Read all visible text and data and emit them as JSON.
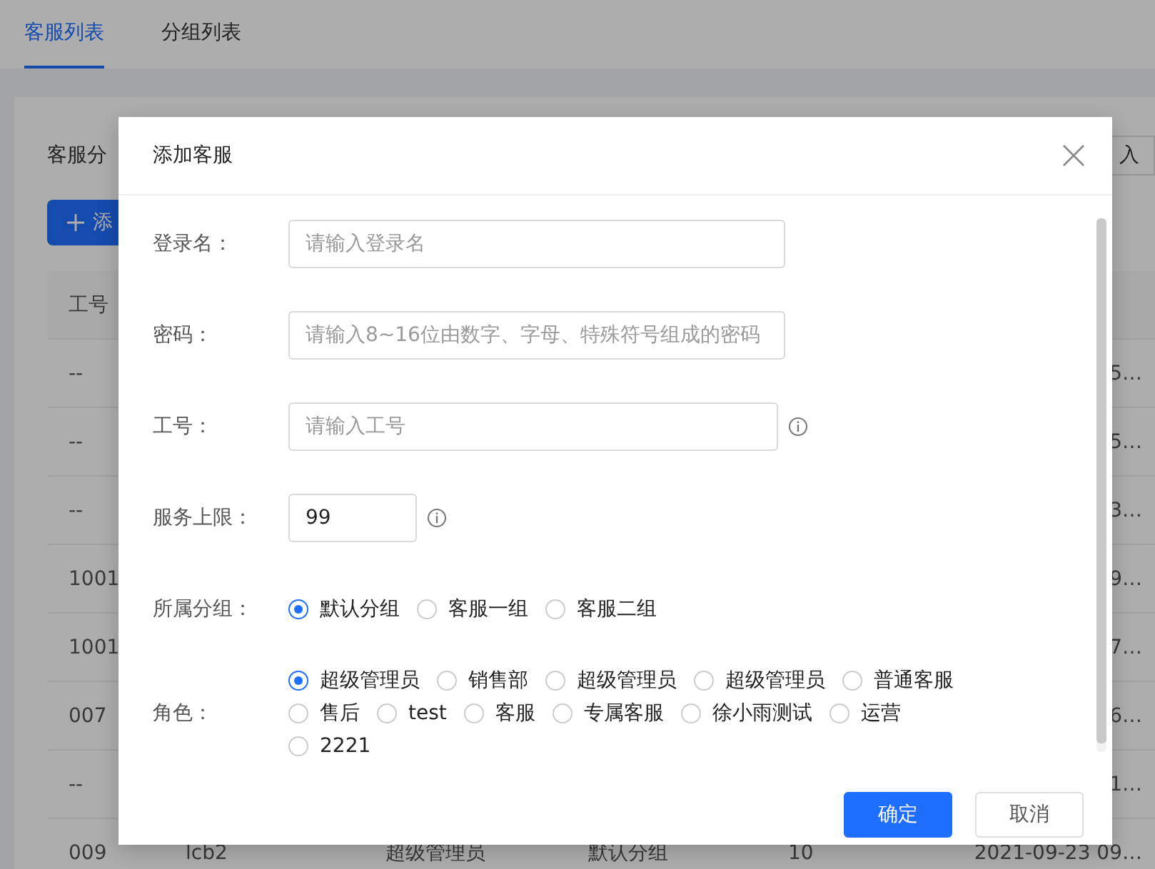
{
  "tabs": [
    {
      "label": "客服列表",
      "selected": true
    },
    {
      "label": "分组列表",
      "selected": false
    }
  ],
  "toolbar": {
    "filter_label": "客服分",
    "add_button": "添",
    "right_button": "入"
  },
  "table": {
    "header": {
      "column_1": "工号"
    },
    "rows": [
      {
        "column_1": "--",
        "column_6": "5…"
      },
      {
        "column_1": "--",
        "column_6": "5…"
      },
      {
        "column_1": "--",
        "column_6": "3…"
      },
      {
        "column_1": "1001",
        "column_6": "9…"
      },
      {
        "column_1": "1001",
        "column_6": "7…"
      },
      {
        "column_1": "007",
        "column_6": "6…"
      },
      {
        "column_1": "--",
        "column_6": "1…"
      },
      {
        "column_1": "009",
        "column_2": "lcb2",
        "column_3": "超级管理员",
        "column_4": "默认分组",
        "column_5": "10",
        "column_6": "2021-09-23 09…"
      }
    ]
  },
  "dialog": {
    "title": "添加客服",
    "fields": [
      {
        "label": "登录名：",
        "placeholder": "请输入登录名",
        "info": false
      },
      {
        "label": "密码：",
        "placeholder": "请输入8~16位由数字、字母、特殊符号组成的密码",
        "info": false
      },
      {
        "label": "工号：",
        "placeholder": "请输入工号",
        "info": true
      },
      {
        "label": "服务上限：",
        "value": "99",
        "info": true
      }
    ],
    "group": {
      "label": "所属分组：",
      "options": [
        {
          "label": "默认分组",
          "selected": true
        },
        {
          "label": "客服一组",
          "selected": false
        },
        {
          "label": "客服二组",
          "selected": false
        }
      ]
    },
    "role": {
      "label": "角色：",
      "options": [
        {
          "label": "超级管理员",
          "selected": true
        },
        {
          "label": "销售部",
          "selected": false
        },
        {
          "label": "超级管理员",
          "selected": false
        },
        {
          "label": "超级管理员",
          "selected": false
        },
        {
          "label": "普通客服",
          "selected": false
        },
        {
          "label": "售后",
          "selected": false
        },
        {
          "label": "test",
          "selected": false
        },
        {
          "label": "客服",
          "selected": false
        },
        {
          "label": "专属客服",
          "selected": false
        },
        {
          "label": "徐小雨测试",
          "selected": false
        },
        {
          "label": "运营",
          "selected": false
        },
        {
          "label": "2221",
          "selected": false
        }
      ]
    },
    "buttons": [
      {
        "label": "确定",
        "kind": "primary"
      },
      {
        "label": "取消",
        "kind": "default"
      }
    ]
  }
}
